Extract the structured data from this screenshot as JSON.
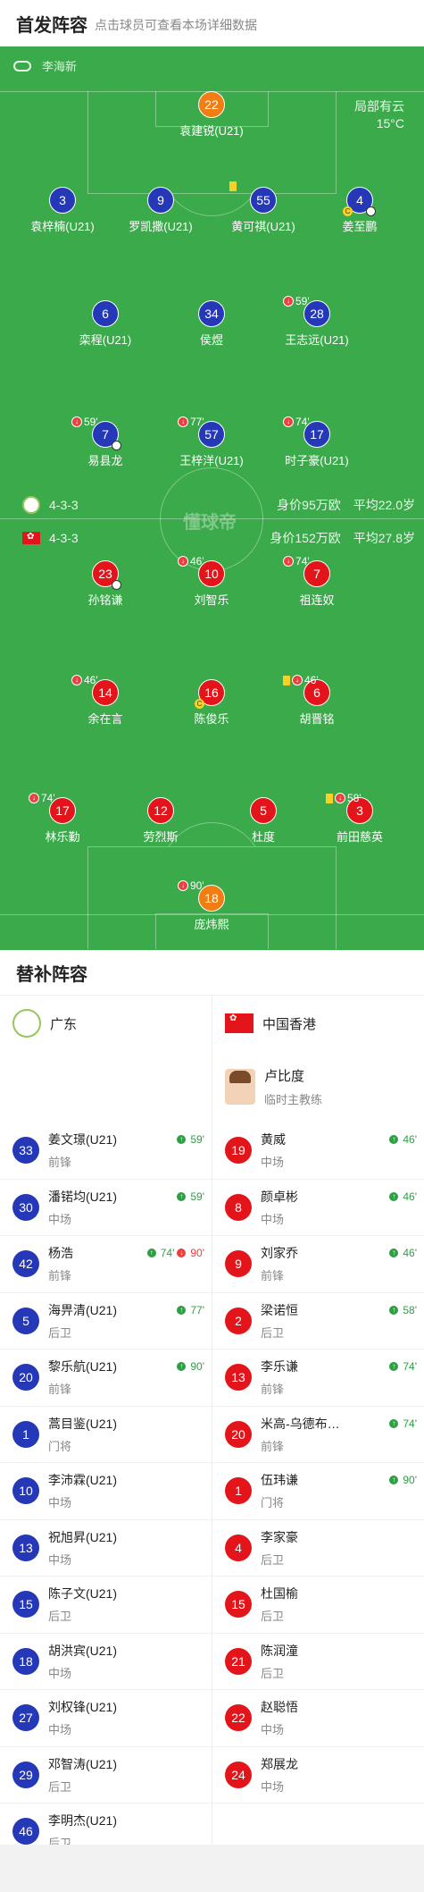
{
  "header": {
    "title": "首发阵容",
    "subtitle": "点击球员可查看本场详细数据"
  },
  "referee": "李海新",
  "weather": {
    "cond": "局部有云",
    "temp": "15°C"
  },
  "watermark": "懂球帝",
  "home": {
    "name": "广东",
    "formation": "4-3-3",
    "value": "身价95万欧",
    "age": "平均22.0岁"
  },
  "away": {
    "name": "中国香港",
    "formation": "4-3-3",
    "value": "身价152万欧",
    "age": "平均27.8岁"
  },
  "home_lineup": [
    {
      "num": "22",
      "name": "袁建锐(U21)",
      "color": "orange"
    },
    {
      "num": "3",
      "name": "袁梓楠(U21)"
    },
    {
      "num": "9",
      "name": "罗凯撒(U21)"
    },
    {
      "num": "55",
      "name": "黄可祺(U21)"
    },
    {
      "num": "4",
      "name": "姜至鹏"
    },
    {
      "num": "6",
      "name": "栾程(U21)"
    },
    {
      "num": "34",
      "name": "侯煜"
    },
    {
      "num": "28",
      "name": "王志远(U21)",
      "sub": "59'"
    },
    {
      "num": "7",
      "name": "易县龙",
      "sub": "59'"
    },
    {
      "num": "57",
      "name": "王梓洋(U21)",
      "sub": "77'"
    },
    {
      "num": "17",
      "name": "时子豪(U21)",
      "sub": "74'"
    }
  ],
  "away_lineup": [
    {
      "num": "23",
      "name": "孙铭谦"
    },
    {
      "num": "10",
      "name": "刘智乐",
      "sub": "46'"
    },
    {
      "num": "7",
      "name": "祖连奴",
      "sub": "74'"
    },
    {
      "num": "14",
      "name": "余在言",
      "sub": "46'"
    },
    {
      "num": "16",
      "name": "陈俊乐"
    },
    {
      "num": "6",
      "name": "胡晋铭",
      "sub": "46'"
    },
    {
      "num": "17",
      "name": "林乐勤",
      "sub": "74'"
    },
    {
      "num": "12",
      "name": "劳烈斯"
    },
    {
      "num": "5",
      "name": "杜度"
    },
    {
      "num": "3",
      "name": "前田慈英",
      "sub": "58'"
    },
    {
      "num": "18",
      "name": "庞炜熙",
      "sub": "90'",
      "color": "orange"
    }
  ],
  "subs_title": "替补阵容",
  "home_subs": [
    {
      "num": "33",
      "name": "姜文璟(U21)",
      "pos": "前锋",
      "ev": "59'"
    },
    {
      "num": "30",
      "name": "潘锘均(U21)",
      "pos": "中场",
      "ev": "59'"
    },
    {
      "num": "42",
      "name": "杨浩",
      "pos": "前锋",
      "ev": "74'",
      "ev_out": "90'"
    },
    {
      "num": "5",
      "name": "海畀清(U21)",
      "pos": "后卫",
      "ev": "77'"
    },
    {
      "num": "20",
      "name": "黎乐航(U21)",
      "pos": "前锋",
      "ev": "90'"
    },
    {
      "num": "1",
      "name": "蒿目鉴(U21)",
      "pos": "门将"
    },
    {
      "num": "10",
      "name": "李沛霖(U21)",
      "pos": "中场"
    },
    {
      "num": "13",
      "name": "祝旭昇(U21)",
      "pos": "中场"
    },
    {
      "num": "15",
      "name": "陈子文(U21)",
      "pos": "后卫"
    },
    {
      "num": "18",
      "name": "胡洪宾(U21)",
      "pos": "中场"
    },
    {
      "num": "27",
      "name": "刘权锋(U21)",
      "pos": "中场"
    },
    {
      "num": "29",
      "name": "邓智涛(U21)",
      "pos": "后卫"
    },
    {
      "num": "46",
      "name": "李明杰(U21)",
      "pos": "后卫"
    }
  ],
  "coach": {
    "name": "卢比度",
    "role": "临时主教练"
  },
  "away_subs": [
    {
      "num": "19",
      "name": "黄威",
      "pos": "中场",
      "ev": "46'"
    },
    {
      "num": "8",
      "name": "颜卓彬",
      "pos": "中场",
      "ev": "46'"
    },
    {
      "num": "9",
      "name": "刘家乔",
      "pos": "前锋",
      "ev": "46'"
    },
    {
      "num": "2",
      "name": "梁诺恒",
      "pos": "后卫",
      "ev": "58'"
    },
    {
      "num": "13",
      "name": "李乐谦",
      "pos": "前锋",
      "ev": "74'"
    },
    {
      "num": "20",
      "name": "米高-乌德布…",
      "pos": "前锋",
      "ev": "74'"
    },
    {
      "num": "1",
      "name": "伍玮谦",
      "pos": "门将",
      "ev": "90'"
    },
    {
      "num": "4",
      "name": "李家豪",
      "pos": "后卫"
    },
    {
      "num": "15",
      "name": "杜国榆",
      "pos": "后卫"
    },
    {
      "num": "21",
      "name": "陈润潼",
      "pos": "后卫"
    },
    {
      "num": "22",
      "name": "赵聪悟",
      "pos": "中场"
    },
    {
      "num": "24",
      "name": "郑展龙",
      "pos": "中场"
    }
  ]
}
